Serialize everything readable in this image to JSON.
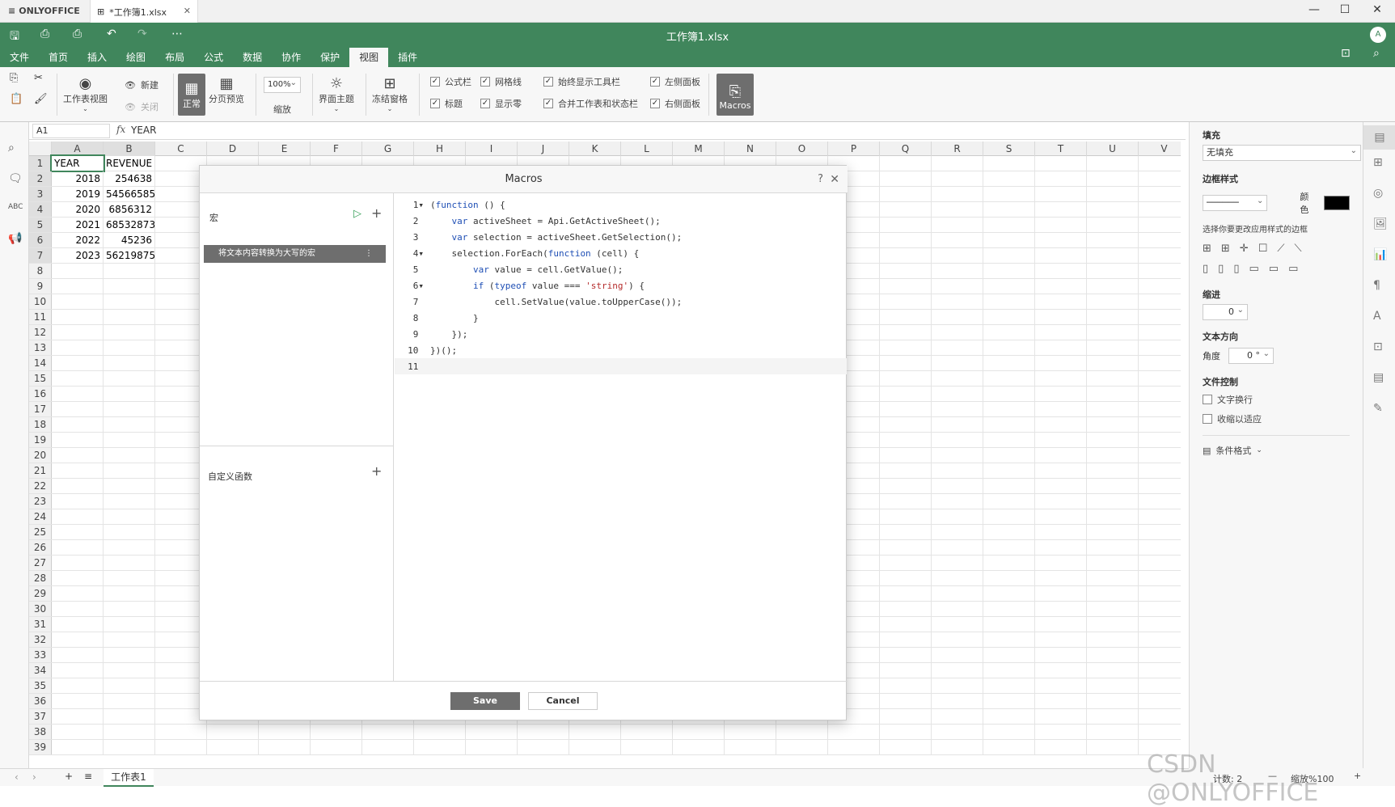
{
  "app": {
    "brand": "ONLYOFFICE",
    "tab_label": "*工作簿1.xlsx",
    "doc_title": "工作簿1.xlsx",
    "avatar": "A"
  },
  "menu": {
    "tabs": [
      "文件",
      "首页",
      "插入",
      "绘图",
      "布局",
      "公式",
      "数据",
      "协作",
      "保护",
      "视图",
      "插件"
    ],
    "active": "视图"
  },
  "ribbon": {
    "sheet_view": "工作表视图",
    "new": "新建",
    "close": "关闭",
    "normal": "正常",
    "page_break": "分页预览",
    "zoom_value": "100%",
    "zoom": "缩放",
    "theme": "界面主题",
    "freeze": "冻结窗格",
    "checks": [
      {
        "label": "公式栏",
        "checked": true
      },
      {
        "label": "网格线",
        "checked": true
      },
      {
        "label": "始终显示工具栏",
        "checked": true
      },
      {
        "label": "左侧面板",
        "checked": true
      },
      {
        "label": "标题",
        "checked": true
      },
      {
        "label": "显示零",
        "checked": true
      },
      {
        "label": "合并工作表和状态栏",
        "checked": true
      },
      {
        "label": "右侧面板",
        "checked": true
      }
    ],
    "macros": "Macros"
  },
  "formula": {
    "cell_ref": "A1",
    "fx": "fx",
    "value": "YEAR"
  },
  "grid": {
    "columns": [
      "A",
      "B",
      "C",
      "D",
      "E",
      "F",
      "G",
      "H",
      "I",
      "J",
      "K",
      "L",
      "M",
      "N",
      "O",
      "P",
      "Q",
      "R",
      "S",
      "T",
      "U",
      "V"
    ],
    "rows": [
      [
        "YEAR",
        "REVENUE"
      ],
      [
        "2018",
        "254638"
      ],
      [
        "2019",
        "54566585"
      ],
      [
        "2020",
        "6856312"
      ],
      [
        "2021",
        "68532873"
      ],
      [
        "2022",
        "45236"
      ],
      [
        "2023",
        "56219875"
      ]
    ],
    "row_count": 39
  },
  "sheet_tab": "工作表1",
  "panel": {
    "fill_title": "填充",
    "fill_value": "无填充",
    "border_title": "边框样式",
    "color_label": "颜色",
    "border_hint": "选择你要更改应用样式的边框",
    "indent_title": "缩进",
    "indent_value": "0",
    "textdir_title": "文本方向",
    "angle_label": "角度",
    "angle_value": "0 °",
    "control_title": "文件控制",
    "wrap": "文字换行",
    "shrink": "收缩以适应",
    "cond": "条件格式"
  },
  "status": {
    "count": "计数: 2",
    "zoom": "缩放%100"
  },
  "macros": {
    "title": "Macros",
    "section_macro": "宏",
    "macro_item": "将文本内容转换为大写的宏",
    "section_func": "自定义函数",
    "save": "Save",
    "cancel": "Cancel",
    "code": [
      "(function () {",
      "    var activeSheet = Api.GetActiveSheet();",
      "    var selection = activeSheet.GetSelection();",
      "    selection.ForEach(function (cell) {",
      "        var value = cell.GetValue();",
      "        if (typeof value === 'string') {",
      "            cell.SetValue(value.toUpperCase());",
      "        }",
      "    });",
      "})();",
      ""
    ]
  },
  "watermark": "CSDN @ONLYOFFICE",
  "colors": {
    "header": "#40865c"
  }
}
